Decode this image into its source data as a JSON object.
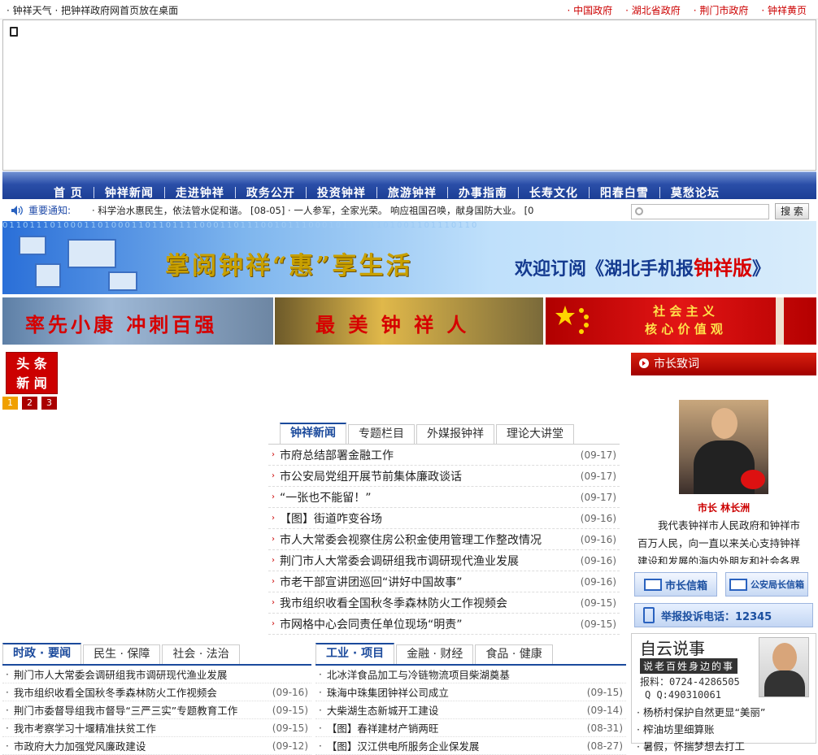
{
  "topbar": {
    "left": "· 钟祥天气 · 把钟祥政府网首页放在桌面",
    "links": [
      "· 中国政府",
      "· 湖北省政府",
      "· 荆门市政府",
      "· 钟祥黄页"
    ]
  },
  "nav": [
    "首 页",
    "钟祥新闻",
    "走进钟祥",
    "政务公开",
    "投资钟祥",
    "旅游钟祥",
    "办事指南",
    "长寿文化",
    "阳春白雪",
    "莫愁论坛"
  ],
  "notice": {
    "label": "重要通知:",
    "text": "· 科学治水惠民生，依法管水促和谐。 [08-05] · 一人参军，全家光荣。        响应祖国召唤，献身国防大业。 [0"
  },
  "search": {
    "button": "搜 索",
    "placeholder": ""
  },
  "banners": {
    "main_title": "掌阅钟祥“惠”享生活",
    "main_sub": "欢迎订阅《湖北手机报",
    "main_sub_red": "钟祥版",
    "main_sub_end": "》",
    "b2": "率先小康  冲刺百强",
    "b3": "最 美 钟 祥 人",
    "b4_l1": "社 会 主 义",
    "b4_l2": "核 心 价 值 观"
  },
  "headline": {
    "l1": "头 条",
    "l2": "新 闻",
    "pages": [
      "1",
      "2",
      "3"
    ]
  },
  "news": {
    "tabs": [
      "钟祥新闻",
      "专题栏目",
      "外媒报钟祥",
      "理论大讲堂"
    ],
    "items": [
      {
        "t": "市府总结部署金融工作",
        "d": "(09-17)"
      },
      {
        "t": "市公安局党组开展节前集体廉政谈话",
        "d": "(09-17)"
      },
      {
        "t": "“一张也不能留！”",
        "d": "(09-17)"
      },
      {
        "t": "【图】街道咋变谷场",
        "d": "(09-16)"
      },
      {
        "t": "市人大常委会视察住房公积金使用管理工作整改情况",
        "d": "(09-16)"
      },
      {
        "t": "荆门市人大常委会调研组我市调研现代渔业发展",
        "d": "(09-16)"
      },
      {
        "t": "市老干部宣讲团巡回“讲好中国故事”",
        "d": "(09-16)"
      },
      {
        "t": "我市组织收看全国秋冬季森林防火工作视频会",
        "d": "(09-15)"
      },
      {
        "t": "市网格中心会同责任单位现场“明责”",
        "d": "(09-15)"
      }
    ]
  },
  "sidebar": {
    "mayor_head": "市长致词",
    "mayor_name": "市长  林长洲",
    "mayor_text": "我代表钟祥市人民政府和钟祥市百万人民，向一直以来关心支持钟祥建设和发展的海内外朋友和社会各界人士表示衷心感谢！",
    "mail1": "市长信箱",
    "mail2": "公安局长信箱",
    "hotline": "举报投诉电话：12345",
    "ziyun_title": "自云说事",
    "ziyun_sub": "说老百姓身边的事",
    "ziyun_phone": "报料：0724-4286505",
    "ziyun_qq": "Q Q:490310061",
    "ziyun_items": [
      "· 杨桥村保护自然更显“美丽”",
      "· 榨油坊里细算账",
      "· 暑假，怀揣梦想去打工"
    ]
  },
  "col1": {
    "tabs": [
      "时政 · 要闻",
      "民生 · 保障",
      "社会 · 法治"
    ],
    "items": [
      {
        "t": "荆门市人大常委会调研组我市调研现代渔业发展",
        "d": ""
      },
      {
        "t": "我市组织收看全国秋冬季森林防火工作视频会",
        "d": "(09-16)"
      },
      {
        "t": "荆门市委督导组我市督导“三严三实”专题教育工作",
        "d": "(09-15)"
      },
      {
        "t": "我市考察学习十堰精准扶贫工作",
        "d": "(09-15)"
      },
      {
        "t": "市政府大力加强党风廉政建设",
        "d": "(09-12)"
      }
    ]
  },
  "col2": {
    "tabs": [
      "工业 · 项目",
      "金融 · 财经",
      "食品 · 健康"
    ],
    "items": [
      {
        "t": "北冰洋食品加工与冷链物流项目柴湖奠基",
        "d": ""
      },
      {
        "t": "珠海中珠集团钟祥公司成立",
        "d": "(09-15)"
      },
      {
        "t": "大柴湖生态新城开工建设",
        "d": "(09-14)"
      },
      {
        "t": "【图】春祥建材产销两旺",
        "d": "(08-31)"
      },
      {
        "t": "【图】汉江供电所服务企业保发展",
        "d": "(08-27)"
      }
    ]
  }
}
